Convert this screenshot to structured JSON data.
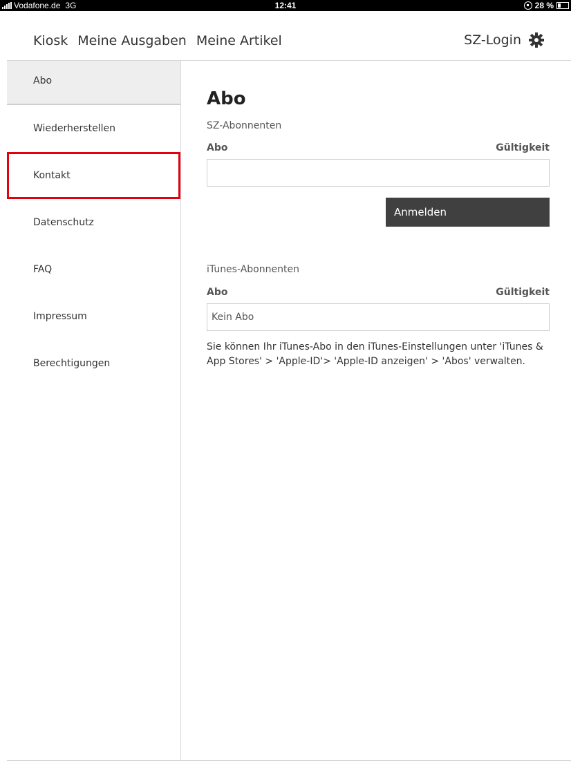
{
  "statusbar": {
    "carrier": "Vodafone.de",
    "network": "3G",
    "time": "12:41",
    "battery": "28 %",
    "battery_level": 0.28
  },
  "topnav": {
    "tabs": [
      {
        "label": "Kiosk"
      },
      {
        "label": "Meine Ausgaben"
      },
      {
        "label": "Meine Artikel"
      }
    ],
    "login_label": "SZ-Login",
    "settings_icon": "gear-icon"
  },
  "sidebar": {
    "items": [
      {
        "label": "Abo",
        "active": true
      },
      {
        "label": "Wiederherstellen"
      },
      {
        "label": "Kontakt",
        "highlighted": true
      },
      {
        "label": "Datenschutz"
      },
      {
        "label": "FAQ"
      },
      {
        "label": "Impressum"
      },
      {
        "label": "Berechtigungen"
      }
    ]
  },
  "main": {
    "title": "Abo",
    "sz_section": {
      "label": "SZ-Abonnenten",
      "col_abo": "Abo",
      "col_validity": "Gültigkeit",
      "field_value": "",
      "button_label": "Anmelden"
    },
    "itunes_section": {
      "label": "iTunes-Abonnenten",
      "col_abo": "Abo",
      "col_validity": "Gültigkeit",
      "field_value": "Kein Abo",
      "info": "Sie können Ihr iTunes-Abo in den iTunes-Einstellungen unter 'iTunes & App Stores' > 'Apple-ID'> 'Apple-ID anzeigen' > 'Abos' verwalten."
    }
  },
  "colors": {
    "highlight": "#e3000f",
    "button": "#404040",
    "active_item": "#eeeeee"
  }
}
